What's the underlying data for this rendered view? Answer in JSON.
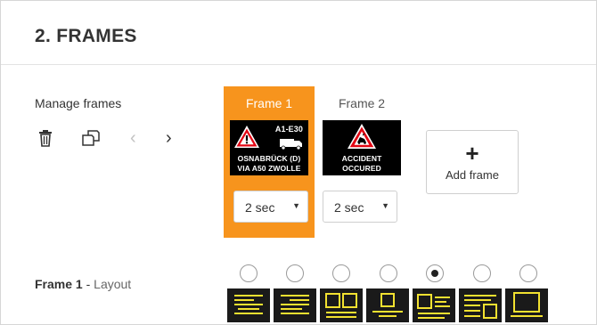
{
  "section": {
    "title": "2. FRAMES"
  },
  "manage": {
    "label": "Manage frames",
    "icons": [
      "trash-icon",
      "duplicate-icon",
      "chevron-left-icon",
      "chevron-right-icon"
    ],
    "prev_glyph": "‹",
    "next_glyph": "›"
  },
  "frames": [
    {
      "label": "Frame 1",
      "active": true,
      "sign": {
        "road": "A1-E30",
        "line1": "OSNABRÜCK (D)",
        "line2": "VIA A50 ZWOLLE"
      },
      "duration": "2 sec"
    },
    {
      "label": "Frame 2",
      "active": false,
      "sign": {
        "line1": "ACCIDENT",
        "line2": "OCCURED"
      },
      "duration": "2 sec"
    }
  ],
  "add_frame": {
    "label": "Add frame",
    "glyph": "+"
  },
  "layout": {
    "label_bold": "Frame 1",
    "label_sep": " - ",
    "label_rest": "Layout",
    "selected_index": 4,
    "options": [
      "layout-text-lines",
      "layout-text-lines-alt",
      "layout-two-boxes",
      "layout-box-top",
      "layout-box-left-text",
      "layout-text-box-right",
      "layout-full-box"
    ]
  },
  "colors": {
    "accent": "#f7941d",
    "sign_background": "#000000",
    "warning_red": "#e30613",
    "layout_yellow": "#f2e130"
  },
  "select_arrow": "▼"
}
